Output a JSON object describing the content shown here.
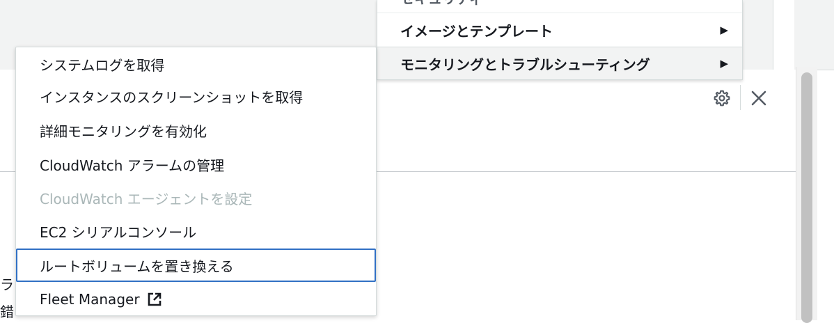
{
  "parent_menu": {
    "partial_item_label": "セキュリティ",
    "items": [
      {
        "label": "イメージとテンプレート",
        "arrow": "▶"
      },
      {
        "label": "モニタリングとトラブルシューティング",
        "arrow": "▶"
      }
    ]
  },
  "submenu": {
    "items": [
      {
        "label": "システムログを取得"
      },
      {
        "label": "インスタンスのスクリーンショットを取得"
      },
      {
        "label": "詳細モニタリングを有効化"
      },
      {
        "label": "CloudWatch アラームの管理"
      },
      {
        "label": "CloudWatch エージェントを設定",
        "disabled": true
      },
      {
        "label": "EC2 シリアルコンソール"
      },
      {
        "label": "ルートボリュームを置き換える",
        "focused": true
      },
      {
        "label": "Fleet Manager",
        "external": true
      }
    ]
  },
  "panel": {
    "settings_icon": "gear-icon",
    "close_icon": "close-icon",
    "background_fragments": [
      "ラ",
      "錯"
    ]
  },
  "colors": {
    "focus_border": "#3170c4",
    "disabled_text": "#aab7b8",
    "active_item_bg": "#f2f3f3"
  }
}
